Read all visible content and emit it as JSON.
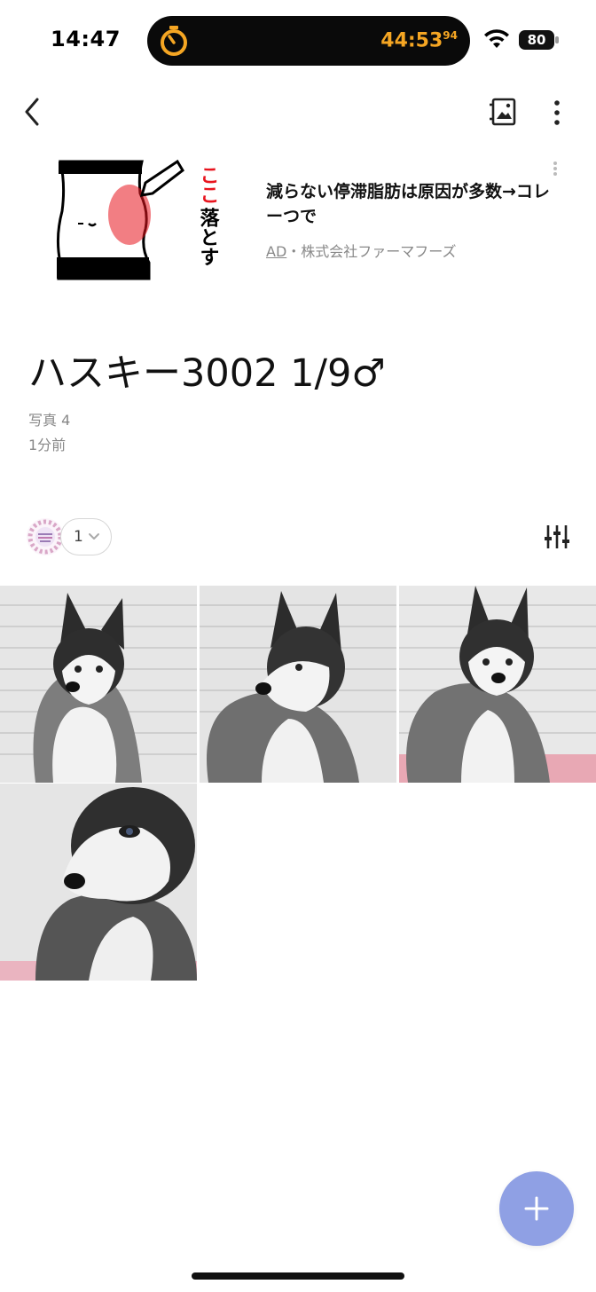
{
  "status_bar": {
    "time": "14:47",
    "timer": "44:53",
    "timer_fraction": "94",
    "battery": "80"
  },
  "ad": {
    "image_text_red": "ここ",
    "image_text_black": "落とす",
    "title": "減らない停滞脂肪は原因が多数→コレーつで",
    "label": "AD",
    "separator": "・",
    "advertiser": "株式会社ファーマフーズ"
  },
  "album": {
    "title": "ハスキー3002  1/9♂",
    "photo_count": "写真 4",
    "updated": "1分前"
  },
  "members": {
    "count": "1"
  },
  "colors": {
    "accent_fab": "#8fa0e4",
    "timer": "#f5a623",
    "ad_red": "#e8141e"
  },
  "icons": {
    "back": "chevron-left-icon",
    "gallery": "gallery-icon",
    "more": "more-vertical-icon",
    "filter": "sliders-icon",
    "add": "plus-icon"
  }
}
